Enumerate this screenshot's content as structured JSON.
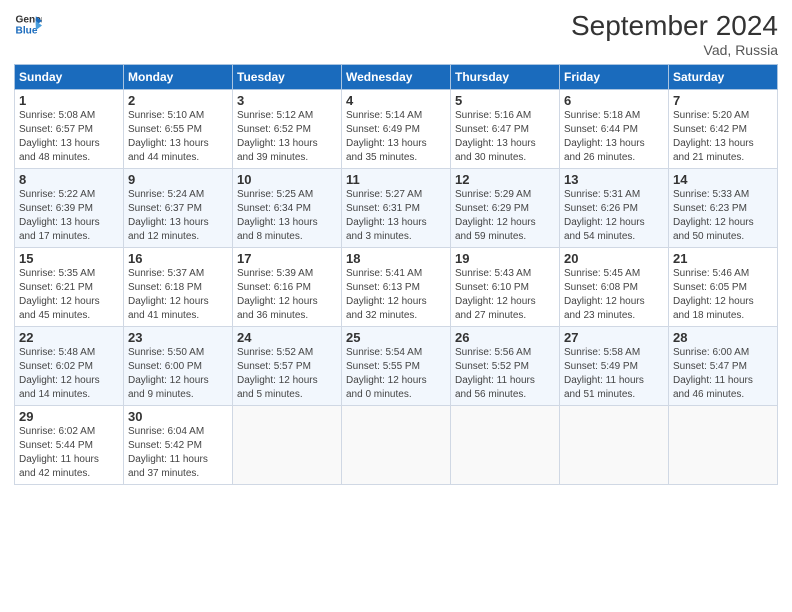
{
  "logo": {
    "line1": "General",
    "line2": "Blue"
  },
  "title": "September 2024",
  "location": "Vad, Russia",
  "days_of_week": [
    "Sunday",
    "Monday",
    "Tuesday",
    "Wednesday",
    "Thursday",
    "Friday",
    "Saturday"
  ],
  "weeks": [
    [
      {
        "day": "1",
        "info": "Sunrise: 5:08 AM\nSunset: 6:57 PM\nDaylight: 13 hours\nand 48 minutes."
      },
      {
        "day": "2",
        "info": "Sunrise: 5:10 AM\nSunset: 6:55 PM\nDaylight: 13 hours\nand 44 minutes."
      },
      {
        "day": "3",
        "info": "Sunrise: 5:12 AM\nSunset: 6:52 PM\nDaylight: 13 hours\nand 39 minutes."
      },
      {
        "day": "4",
        "info": "Sunrise: 5:14 AM\nSunset: 6:49 PM\nDaylight: 13 hours\nand 35 minutes."
      },
      {
        "day": "5",
        "info": "Sunrise: 5:16 AM\nSunset: 6:47 PM\nDaylight: 13 hours\nand 30 minutes."
      },
      {
        "day": "6",
        "info": "Sunrise: 5:18 AM\nSunset: 6:44 PM\nDaylight: 13 hours\nand 26 minutes."
      },
      {
        "day": "7",
        "info": "Sunrise: 5:20 AM\nSunset: 6:42 PM\nDaylight: 13 hours\nand 21 minutes."
      }
    ],
    [
      {
        "day": "8",
        "info": "Sunrise: 5:22 AM\nSunset: 6:39 PM\nDaylight: 13 hours\nand 17 minutes."
      },
      {
        "day": "9",
        "info": "Sunrise: 5:24 AM\nSunset: 6:37 PM\nDaylight: 13 hours\nand 12 minutes."
      },
      {
        "day": "10",
        "info": "Sunrise: 5:25 AM\nSunset: 6:34 PM\nDaylight: 13 hours\nand 8 minutes."
      },
      {
        "day": "11",
        "info": "Sunrise: 5:27 AM\nSunset: 6:31 PM\nDaylight: 13 hours\nand 3 minutes."
      },
      {
        "day": "12",
        "info": "Sunrise: 5:29 AM\nSunset: 6:29 PM\nDaylight: 12 hours\nand 59 minutes."
      },
      {
        "day": "13",
        "info": "Sunrise: 5:31 AM\nSunset: 6:26 PM\nDaylight: 12 hours\nand 54 minutes."
      },
      {
        "day": "14",
        "info": "Sunrise: 5:33 AM\nSunset: 6:23 PM\nDaylight: 12 hours\nand 50 minutes."
      }
    ],
    [
      {
        "day": "15",
        "info": "Sunrise: 5:35 AM\nSunset: 6:21 PM\nDaylight: 12 hours\nand 45 minutes."
      },
      {
        "day": "16",
        "info": "Sunrise: 5:37 AM\nSunset: 6:18 PM\nDaylight: 12 hours\nand 41 minutes."
      },
      {
        "day": "17",
        "info": "Sunrise: 5:39 AM\nSunset: 6:16 PM\nDaylight: 12 hours\nand 36 minutes."
      },
      {
        "day": "18",
        "info": "Sunrise: 5:41 AM\nSunset: 6:13 PM\nDaylight: 12 hours\nand 32 minutes."
      },
      {
        "day": "19",
        "info": "Sunrise: 5:43 AM\nSunset: 6:10 PM\nDaylight: 12 hours\nand 27 minutes."
      },
      {
        "day": "20",
        "info": "Sunrise: 5:45 AM\nSunset: 6:08 PM\nDaylight: 12 hours\nand 23 minutes."
      },
      {
        "day": "21",
        "info": "Sunrise: 5:46 AM\nSunset: 6:05 PM\nDaylight: 12 hours\nand 18 minutes."
      }
    ],
    [
      {
        "day": "22",
        "info": "Sunrise: 5:48 AM\nSunset: 6:02 PM\nDaylight: 12 hours\nand 14 minutes."
      },
      {
        "day": "23",
        "info": "Sunrise: 5:50 AM\nSunset: 6:00 PM\nDaylight: 12 hours\nand 9 minutes."
      },
      {
        "day": "24",
        "info": "Sunrise: 5:52 AM\nSunset: 5:57 PM\nDaylight: 12 hours\nand 5 minutes."
      },
      {
        "day": "25",
        "info": "Sunrise: 5:54 AM\nSunset: 5:55 PM\nDaylight: 12 hours\nand 0 minutes."
      },
      {
        "day": "26",
        "info": "Sunrise: 5:56 AM\nSunset: 5:52 PM\nDaylight: 11 hours\nand 56 minutes."
      },
      {
        "day": "27",
        "info": "Sunrise: 5:58 AM\nSunset: 5:49 PM\nDaylight: 11 hours\nand 51 minutes."
      },
      {
        "day": "28",
        "info": "Sunrise: 6:00 AM\nSunset: 5:47 PM\nDaylight: 11 hours\nand 46 minutes."
      }
    ],
    [
      {
        "day": "29",
        "info": "Sunrise: 6:02 AM\nSunset: 5:44 PM\nDaylight: 11 hours\nand 42 minutes."
      },
      {
        "day": "30",
        "info": "Sunrise: 6:04 AM\nSunset: 5:42 PM\nDaylight: 11 hours\nand 37 minutes."
      },
      {
        "day": "",
        "info": ""
      },
      {
        "day": "",
        "info": ""
      },
      {
        "day": "",
        "info": ""
      },
      {
        "day": "",
        "info": ""
      },
      {
        "day": "",
        "info": ""
      }
    ]
  ]
}
